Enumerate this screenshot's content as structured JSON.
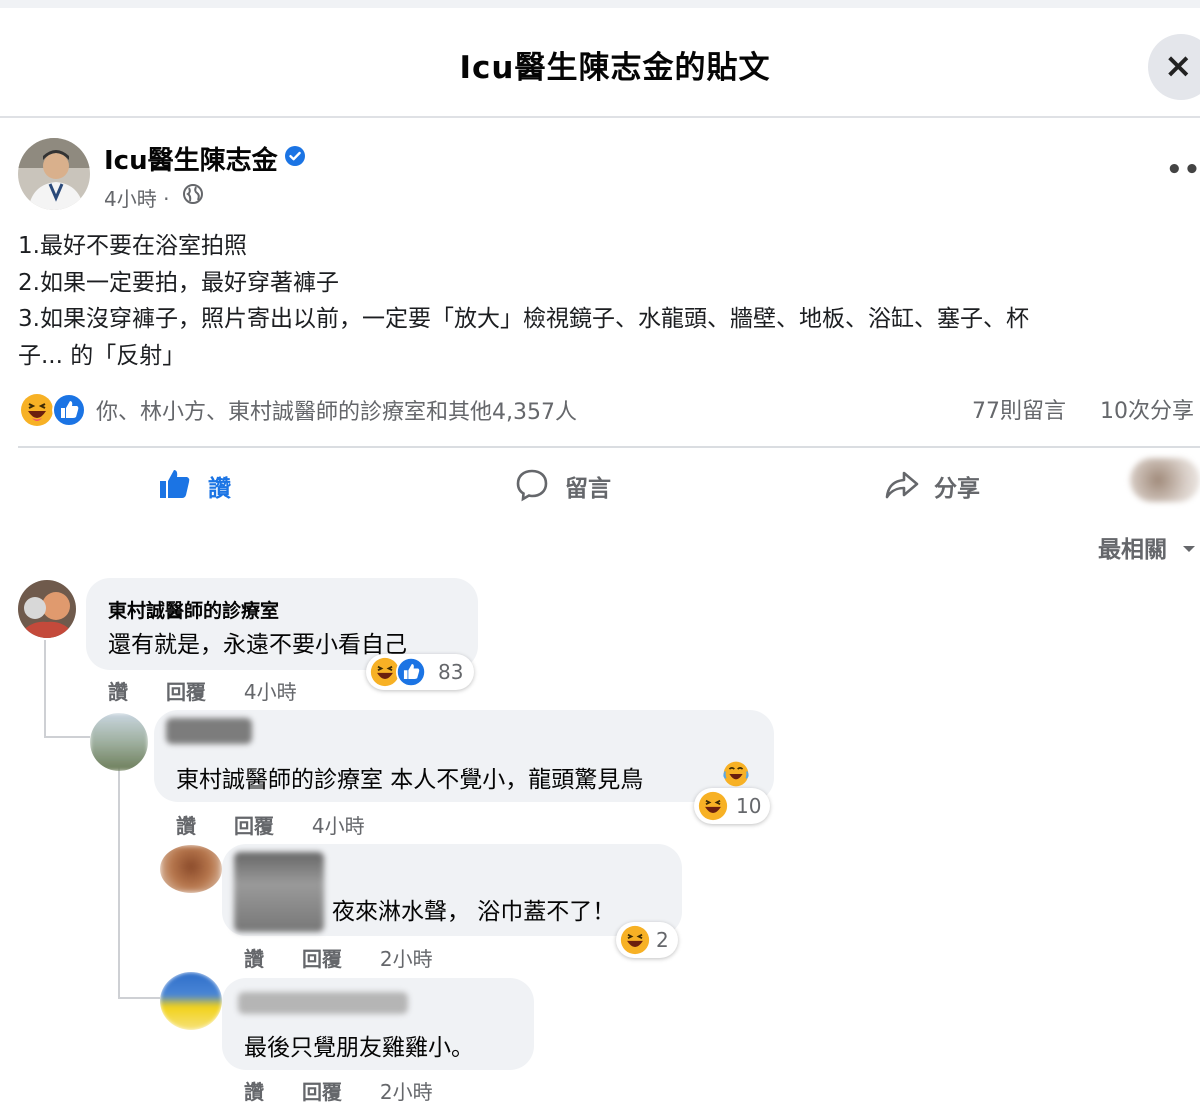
{
  "header": {
    "title": "Icu醫生陳志金的貼文",
    "close_label": "×"
  },
  "post": {
    "author": "Icu醫生陳志金",
    "time": "4小時 ·",
    "more_label": "•••",
    "lines": [
      "1.最好不要在浴室拍照",
      "2.如果一定要拍，最好穿著褲子",
      "3.如果沒穿褲子，照片寄出以前，一定要「放大」檢視鏡子、水龍頭、牆壁、地板、浴缸、塞子、杯",
      "子... 的「反射」"
    ],
    "reactors_text": "你、林小方、東村誠醫師的診療室和其他4,357人",
    "comments_count": "77則留言",
    "shares_count": "10次分享"
  },
  "actions": {
    "like": "讚",
    "comment": "留言",
    "share": "分享"
  },
  "sort_label": "最相關",
  "comments": [
    {
      "author": "東村誠醫師的診療室",
      "text": "還有就是，永遠不要小看自己",
      "like": "讚",
      "reply": "回覆",
      "time": "4小時",
      "reactions": "83"
    },
    {
      "author": "",
      "text": "東村誠醫師的診療室 本人不覺小，龍頭驚見鳥",
      "like": "讚",
      "reply": "回覆",
      "time": "4小時",
      "reactions": "10"
    },
    {
      "author": "",
      "text": "夜來淋水聲， 浴巾蓋不了！",
      "like": "讚",
      "reply": "回覆",
      "time": "2小時",
      "reactions": "2"
    },
    {
      "author": "",
      "text": "最後只覺朋友雞雞小。",
      "like": "讚",
      "reply": "回覆",
      "time": "2小時",
      "reactions": ""
    }
  ],
  "colors": {
    "accent": "#1b74e4",
    "bubble": "#f0f2f5",
    "muted": "#65676b",
    "haha": "#f7b125"
  },
  "icons": [
    "close-icon",
    "verified-icon",
    "globe-icon",
    "haha-icon",
    "like-icon",
    "thumbs-up-icon",
    "comment-icon",
    "share-icon",
    "chevron-down-icon"
  ]
}
